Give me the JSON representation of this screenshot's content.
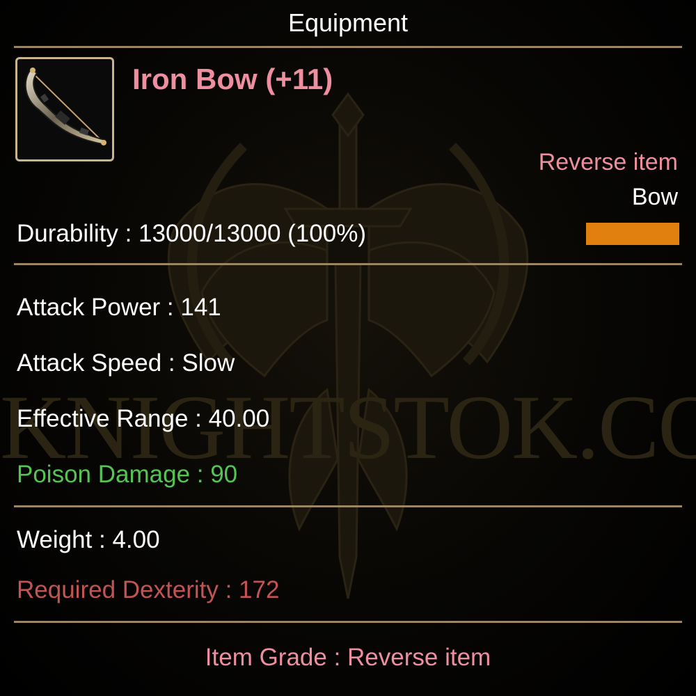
{
  "header": {
    "title": "Equipment"
  },
  "item": {
    "name": "Iron Bow (+11)",
    "icon": "bow-icon",
    "type_label": "Reverse item",
    "kind": "Bow",
    "durability_text": "Durability : 13000/13000 (100%)",
    "durability_fraction": 1.0
  },
  "stats": {
    "attack_power": "Attack Power : 141",
    "attack_speed": "Attack Speed : Slow",
    "effective_range": "Effective Range : 40.00",
    "poison_damage": "Poison Damage : 90"
  },
  "requirements": {
    "weight": "Weight : 4.00",
    "required_dexterity": "Required Dexterity : 172"
  },
  "footer": {
    "grade": "Item Grade : Reverse item"
  },
  "watermark": {
    "text": "KNIGHTSTOK.COM"
  },
  "colors": {
    "item_name": "#ee8fa0",
    "poison": "#55c455",
    "requirement": "#c25454",
    "divider": "#9a8663",
    "durability_bar": "#e2800f"
  }
}
